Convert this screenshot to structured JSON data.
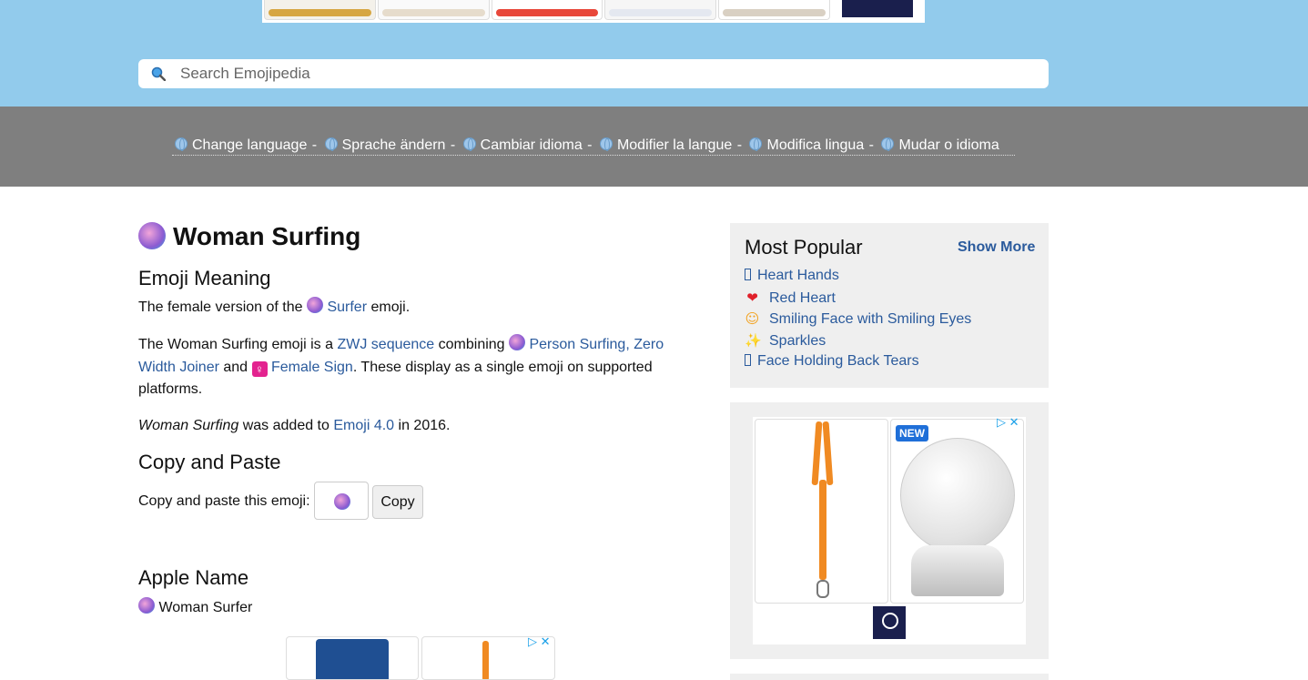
{
  "search": {
    "placeholder": "Search Emojipedia"
  },
  "languages": [
    "Change language",
    "Sprache ändern",
    "Cambiar idioma",
    "Modifier la langue",
    "Modifica lingua",
    "Mudar o idioma"
  ],
  "language_separator": "-",
  "main": {
    "title": "Woman Surfing",
    "meaning_heading": "Emoji Meaning",
    "meaning_p1": {
      "before": "The female version of the",
      "link": "Surfer",
      "after": "emoji."
    },
    "meaning_p2": {
      "t1": "The Woman Surfing emoji is a",
      "zwj_link": "ZWJ sequence",
      "t2": "combining",
      "person_surfing_link": "Person Surfing,",
      "zero_width_link": "Zero Width Joiner",
      "t3": "and",
      "female_sign_glyph": "♀",
      "female_sign_link": "Female Sign",
      "t4": ". These display as a single emoji on supported platforms."
    },
    "added": {
      "name": "Woman Surfing",
      "t1": "was added to",
      "version_link": "Emoji 4.0",
      "t2": "in 2016."
    },
    "copy_heading": "Copy and Paste",
    "copy_label": "Copy and paste this emoji:",
    "copy_button": "Copy",
    "apple_heading": "Apple Name",
    "apple_name": "Woman Surfer"
  },
  "sidebar": {
    "popular_title": "Most Popular",
    "show_more": "Show More",
    "items": [
      {
        "icon": "box",
        "label": "Heart Hands"
      },
      {
        "icon": "❤",
        "icon_color": "#e0202a",
        "label": "Red Heart"
      },
      {
        "icon": "☺",
        "icon_color": "#f2a11c",
        "label": "Smiling Face with Smiling Eyes"
      },
      {
        "icon": "✨",
        "icon_color": "#f5c518",
        "label": "Sparkles"
      },
      {
        "icon": "box",
        "label": "Face Holding Back Tears"
      }
    ],
    "ad_badge": "NEW"
  },
  "colors": {
    "header_bg": "#92cbec",
    "langbar_bg": "#7f7f7f",
    "link": "#2a5a9c",
    "sidebar_bg": "#efefef"
  }
}
